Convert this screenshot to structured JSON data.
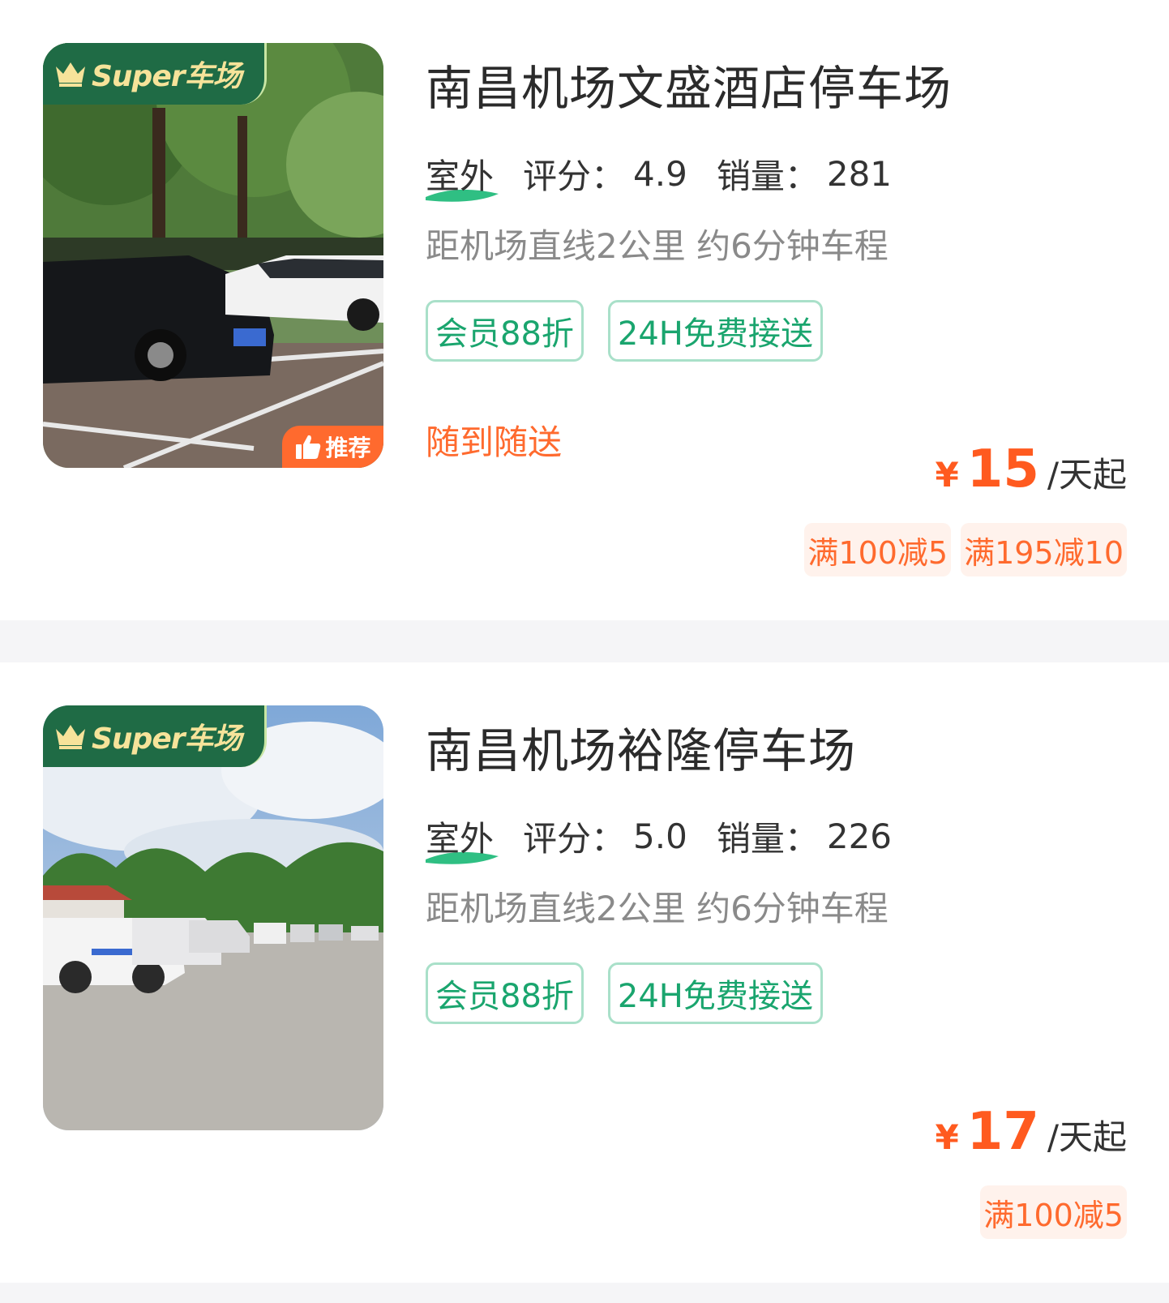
{
  "colors": {
    "brand_green": "#1f6b45",
    "tag_green": "#1aa56e",
    "accent_orange": "#ff5a1f",
    "coupon_bg": "#fff2ec",
    "separator": "#f5f5f7"
  },
  "listings": [
    {
      "image_badge": "Super车场",
      "recommend_badge": "推荐",
      "title": "南昌机场文盛酒店停车场",
      "type": "室外",
      "rating_label": "评分：",
      "rating": "4.9",
      "sales_label": "销量：",
      "sales": "281",
      "distance": "距机场直线2公里 约6分钟车程",
      "tags": [
        "会员88折",
        "24H免费接送"
      ],
      "service": "随到随送",
      "price_symbol": "¥",
      "price": "15",
      "price_unit": "/天起",
      "coupons": [
        "满100减5",
        "满195减10"
      ]
    },
    {
      "image_badge": "Super车场",
      "title": "南昌机场裕隆停车场",
      "type": "室外",
      "rating_label": "评分：",
      "rating": "5.0",
      "sales_label": "销量：",
      "sales": "226",
      "distance": "距机场直线2公里 约6分钟车程",
      "tags": [
        "会员88折",
        "24H免费接送"
      ],
      "price_symbol": "¥",
      "price": "17",
      "price_unit": "/天起",
      "coupons": [
        "满100减5"
      ]
    }
  ]
}
